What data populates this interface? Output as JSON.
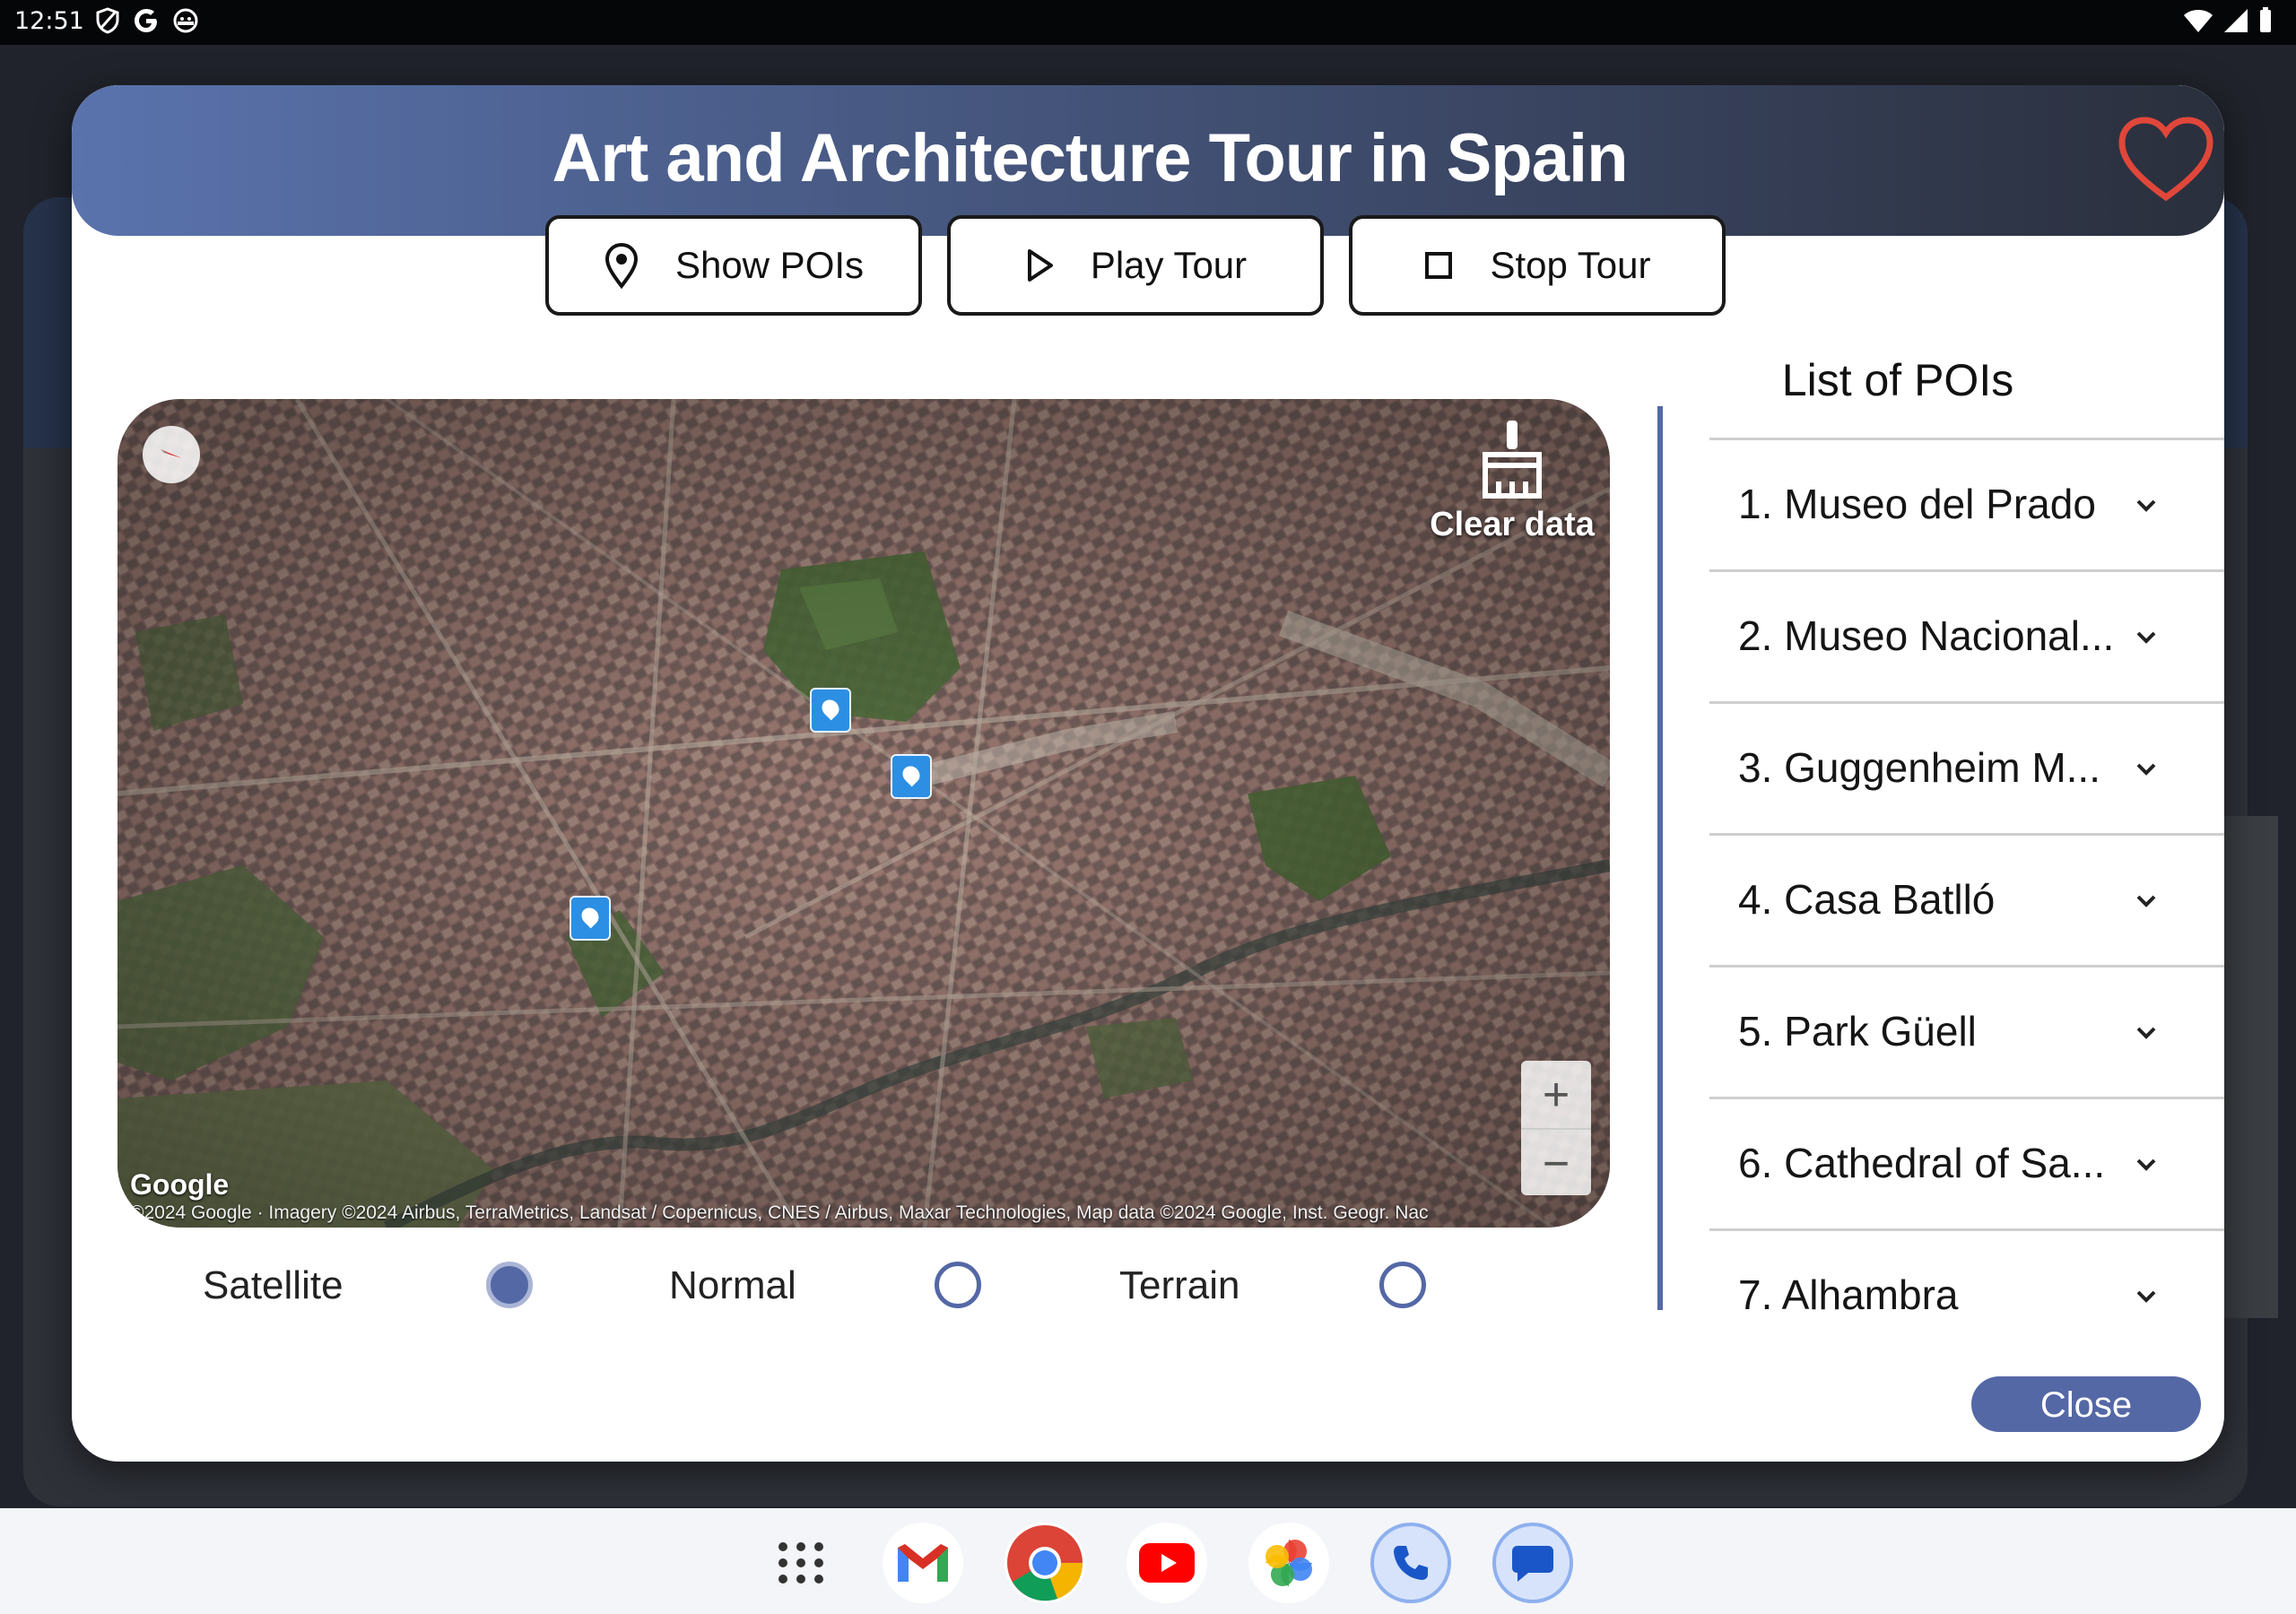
{
  "status_bar": {
    "time": "12:51"
  },
  "dialog": {
    "title": "Art and Architecture Tour in Spain",
    "actions": [
      {
        "label": "Show POIs",
        "icon": "location-pin-icon"
      },
      {
        "label": "Play Tour",
        "icon": "play-icon"
      },
      {
        "label": "Stop Tour",
        "icon": "stop-icon"
      }
    ],
    "map": {
      "clear_data_label": "Clear data",
      "google_logo": "Google",
      "attribution": "©2024 Google · Imagery ©2024 Airbus, TerraMetrics, Landsat / Copernicus, CNES / Airbus, Maxar Technologies, Map data ©2024 Google, Inst. Geogr. Nac",
      "zoom_in": "+",
      "zoom_out": "−"
    },
    "map_types": [
      {
        "label": "Satellite",
        "selected": true
      },
      {
        "label": "Normal",
        "selected": false
      },
      {
        "label": "Terrain",
        "selected": false
      }
    ],
    "poi_list": {
      "title": "List of POIs",
      "items": [
        "1. Museo del Prado",
        "2. Museo Nacional...",
        "3. Guggenheim M...",
        "4. Casa Batlló",
        "5. Park Güell",
        "6. Cathedral of Sa...",
        "7. Alhambra"
      ]
    },
    "close_label": "Close"
  },
  "colors": {
    "accent": "#5468a6",
    "header_start": "#5a73ad",
    "header_end": "#2a2f3c",
    "favorite": "#e0473a"
  },
  "dock_apps": [
    "app-drawer-icon",
    "gmail-icon",
    "chrome-icon",
    "youtube-icon",
    "photos-icon",
    "phone-icon",
    "messages-icon"
  ]
}
